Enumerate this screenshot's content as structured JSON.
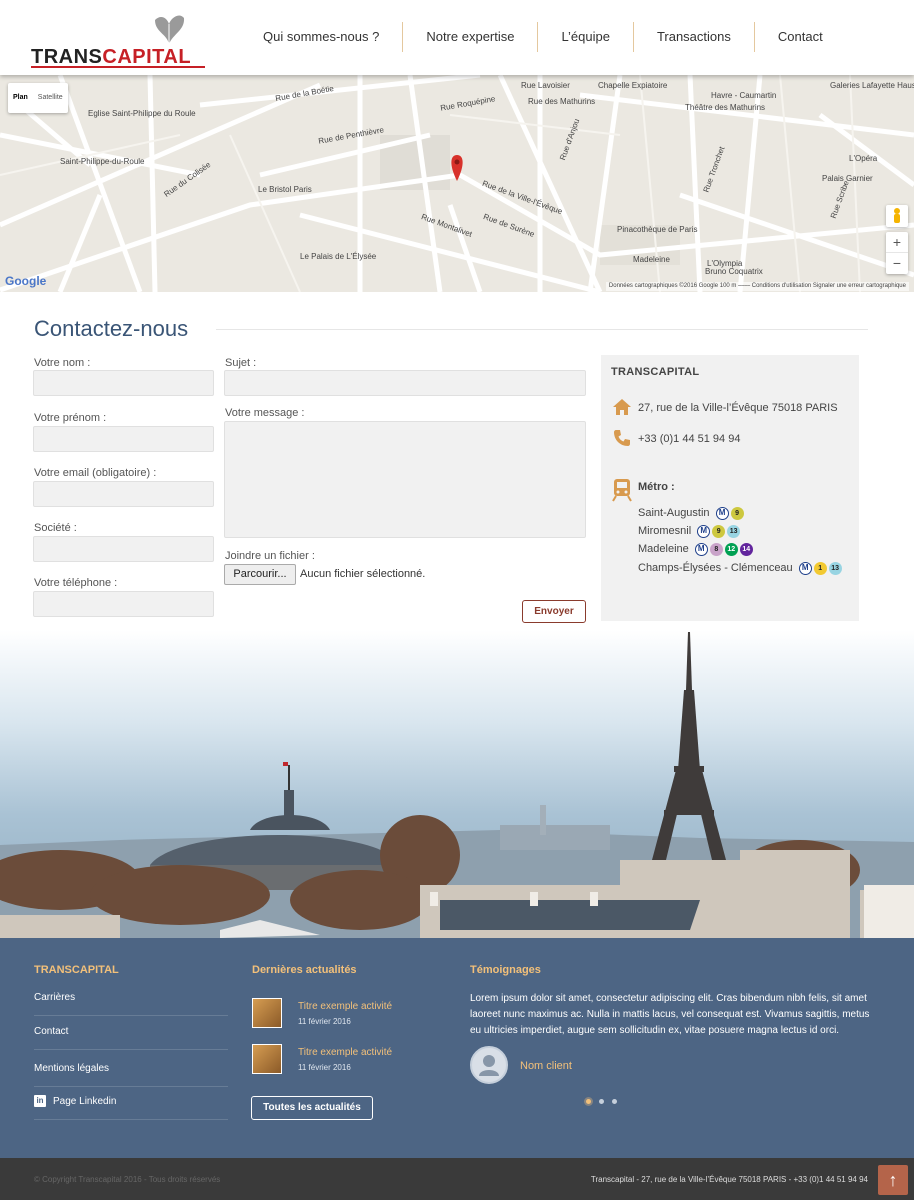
{
  "header": {
    "logo_text_dark": "TRANS",
    "logo_text_red": "CAPITAL",
    "nav": [
      "Qui sommes-nous ?",
      "Notre expertise",
      "L’équipe",
      "Transactions",
      "Contact"
    ]
  },
  "map": {
    "type_plan": "Plan",
    "type_satellite": "Satellite",
    "google": "Google",
    "footer": "Données cartographiques ©2016 Google   100 m ⎯⎯⎯⎯   Conditions d'utilisation   Signaler une erreur cartographique",
    "zoom_in": "+",
    "zoom_out": "−",
    "labels": [
      "Rue Lavoisier",
      "Chapelle Expiatoire",
      "Havre - Caumartin",
      "Galeries Lafayette Haussmann",
      "Rue de la Boétie",
      "Eglise Saint-Philippe du Roule",
      "Rue Roquépine",
      "Rue des Mathurins",
      "Théâtre des Mathurins",
      "Rue de Penthièvre",
      "Saint-Philippe-du-Roule",
      "Rue du Colisée",
      "Le Bristol Paris",
      "Rue de la Ville-l'Évêque",
      "Rue de Surène",
      "Rue Montalivet",
      "Pinacothèque de Paris",
      "Madeleine",
      "L'Olympia",
      "Bruno Coquatrix",
      "L'Opéra",
      "Palais Garnier",
      "Le Palais de L'Élysée",
      "Rue d'Anjou",
      "Rue Tronchet",
      "Rue Scribe"
    ]
  },
  "form": {
    "title": "Contactez-nous",
    "nom": "Votre nom :",
    "prenom": "Votre prénom :",
    "email": "Votre email (obligatoire) :",
    "societe": "Société :",
    "telephone": "Votre téléphone :",
    "sujet": "Sujet :",
    "message": "Votre message :",
    "fichier": "Joindre un fichier :",
    "file_button": "Parcourir...",
    "file_status": "Aucun fichier sélectionné.",
    "send": "Envoyer"
  },
  "info": {
    "title": "TRANSCAPITAL",
    "address": "27, rue de la Ville-l’Évêque 75018 PARIS",
    "phone": "+33 (0)1 44 51 94 94",
    "metro_label": "Métro :",
    "stations": [
      {
        "name": "Saint-Augustin",
        "lines": [
          "9"
        ]
      },
      {
        "name": "Miromesnil",
        "lines": [
          "9",
          "13"
        ]
      },
      {
        "name": "Madeleine",
        "lines": [
          "8",
          "12",
          "14"
        ]
      },
      {
        "name": "Champs-Élysées - Clémenceau",
        "lines": [
          "1",
          "13"
        ]
      }
    ],
    "metro_symbol": "M",
    "line_colors": {
      "1": "#f2c931",
      "8": "#c9a3c9",
      "9": "#cdc83f",
      "12": "#00a052",
      "13": "#98d4e2",
      "14": "#62259d"
    }
  },
  "footer": {
    "col1_title": "TRANSCAPITAL",
    "links": [
      "Carrières",
      "Contact",
      "Mentions légales",
      "Page Linkedin"
    ],
    "col2_title": "Dernières actualités",
    "news": [
      {
        "title": "Titre exemple activité",
        "date": "11 février 2016"
      },
      {
        "title": "Titre exemple activité",
        "date": "11 février 2016"
      }
    ],
    "all_news": "Toutes les actualités",
    "col3_title": "Témoignages",
    "testimonial": "Lorem ipsum dolor sit amet, consectetur adipiscing elit. Cras bibendum nibh felis, sit amet laoreet nunc maximus ac. Nulla in mattis lacus, vel consequat est. Vivamus sagittis, metus eu ultricies imperdiet, augue sem sollicitudin ex, vitae posuere magna lectus id orci.",
    "client": "Nom client",
    "copyright": "© Copyright Transcapital 2016 - Tous droits réservés",
    "address_line": "Transcapital - 27, rue de la Ville-l’Évêque 75018 PARIS - +33 (0)1 44 51 94 94",
    "top_arrow": "↑",
    "linkedin": "in"
  }
}
